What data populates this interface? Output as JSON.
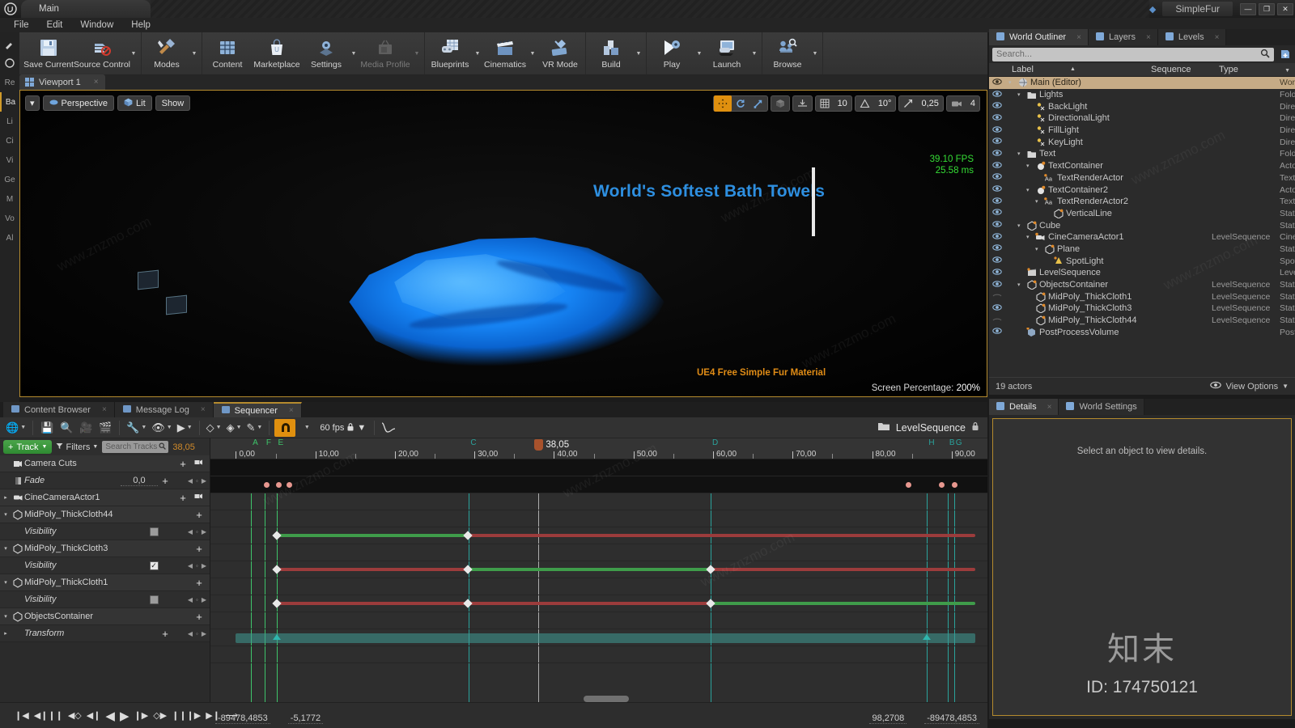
{
  "titlebar": {
    "project_tab": "Main",
    "app_name": "SimpleFur",
    "minimize": "—",
    "maximize": "❐",
    "close": "✕"
  },
  "menubar": {
    "items": [
      "File",
      "Edit",
      "Window",
      "Help"
    ]
  },
  "toolbar": {
    "groups": [
      {
        "buttons": [
          {
            "label": "Save Current",
            "icon": "save-icon",
            "caret": false,
            "disabled": false
          },
          {
            "label": "Source Control",
            "icon": "source-control-icon",
            "caret": true,
            "disabled": false
          }
        ]
      },
      {
        "buttons": [
          {
            "label": "Modes",
            "icon": "modes-icon",
            "caret": true,
            "disabled": false
          }
        ]
      },
      {
        "buttons": [
          {
            "label": "Content",
            "icon": "content-icon",
            "caret": false,
            "disabled": false
          },
          {
            "label": "Marketplace",
            "icon": "marketplace-icon",
            "caret": false,
            "disabled": false
          },
          {
            "label": "Settings",
            "icon": "settings-gear-icon",
            "caret": true,
            "disabled": false
          },
          {
            "label": "Media Profile",
            "icon": "media-profile-icon",
            "caret": true,
            "disabled": true
          }
        ]
      },
      {
        "buttons": [
          {
            "label": "Blueprints",
            "icon": "blueprints-icon",
            "caret": true,
            "disabled": false
          },
          {
            "label": "Cinematics",
            "icon": "cinematics-clapper-icon",
            "caret": true,
            "disabled": false
          },
          {
            "label": "VR Mode",
            "icon": "vr-mode-icon",
            "caret": false,
            "disabled": false
          }
        ]
      },
      {
        "buttons": [
          {
            "label": "Build",
            "icon": "build-icon",
            "caret": true,
            "disabled": false
          }
        ]
      },
      {
        "buttons": [
          {
            "label": "Play",
            "icon": "play-icon",
            "caret": true,
            "disabled": false
          },
          {
            "label": "Launch",
            "icon": "launch-icon",
            "caret": true,
            "disabled": false
          }
        ]
      },
      {
        "buttons": [
          {
            "label": "Browse",
            "icon": "browse-icon",
            "caret": true,
            "disabled": false
          }
        ]
      }
    ]
  },
  "mode_rail": {
    "items": [
      "Re",
      "Ba",
      "Li",
      "Ci",
      "Vi",
      "Ge",
      "M",
      "Vo",
      "Al"
    ],
    "selected_index": 1
  },
  "viewport": {
    "tab_label": "Viewport 1",
    "tab_close": "×",
    "left_controls": [
      {
        "label": "Perspective",
        "icon": "camera-perspective-icon"
      },
      {
        "label": "Lit",
        "icon": "lit-cube-icon"
      },
      {
        "label": "Show",
        "icon": "show-icon"
      }
    ],
    "right_controls": {
      "transform_modes": [
        "move",
        "rotate",
        "scale"
      ],
      "active_transform": "move",
      "coord_space": "world-cube-icon",
      "surface_snap": "surface-snap-icon",
      "grid_snap_icon": "grid-icon",
      "grid_snap_value": "10",
      "angle_snap_icon": "angle-icon",
      "angle_snap_value": "10°",
      "scale_snap_icon": "scale-snap-icon",
      "scale_snap_value": "0,25",
      "camera_speed_icon": "camera-speed-icon",
      "camera_speed_value": "4"
    },
    "stats": {
      "fps": "39.10 FPS",
      "frametime": "25.58 ms"
    },
    "headline_text": "World's Softest Bath Towels",
    "subtitle_text": "UE4 Free Simple Fur Material",
    "screen_percentage_label": "Screen Percentage:",
    "screen_percentage_value": "200%"
  },
  "outliner": {
    "tabs": [
      {
        "label": "World Outliner",
        "icon": "list-icon",
        "active": true,
        "closable": true
      },
      {
        "label": "Layers",
        "icon": "layers-icon",
        "active": false,
        "closable": true
      },
      {
        "label": "Levels",
        "icon": "levels-icon",
        "active": false,
        "closable": true
      }
    ],
    "search_placeholder": "Search...",
    "search_icon": "magnifier-icon",
    "add_icon": "add-actor-icon",
    "columns": {
      "label": "Label",
      "sequence": "Sequence",
      "type": "Type"
    },
    "rows": [
      {
        "label": "Main (Editor)",
        "sequence": "",
        "type": "World",
        "indent": 0,
        "icon": "world-icon",
        "expander": "▾",
        "eye": true,
        "selected": true
      },
      {
        "label": "Lights",
        "sequence": "",
        "type": "Folder",
        "indent": 1,
        "icon": "folder-icon",
        "expander": "▾",
        "eye": true,
        "selected": false
      },
      {
        "label": "BackLight",
        "sequence": "",
        "type": "DirectionalLight",
        "indent": 2,
        "icon": "light-icon",
        "expander": "",
        "eye": true,
        "selected": false
      },
      {
        "label": "DirectionalLight",
        "sequence": "",
        "type": "DirectionalLight",
        "indent": 2,
        "icon": "light-icon",
        "expander": "",
        "eye": true,
        "selected": false
      },
      {
        "label": "FillLight",
        "sequence": "",
        "type": "DirectionalLight",
        "indent": 2,
        "icon": "light-icon",
        "expander": "",
        "eye": true,
        "selected": false
      },
      {
        "label": "KeyLight",
        "sequence": "",
        "type": "DirectionalLight",
        "indent": 2,
        "icon": "light-icon",
        "expander": "",
        "eye": true,
        "selected": false
      },
      {
        "label": "Text",
        "sequence": "",
        "type": "Folder",
        "indent": 1,
        "icon": "folder-icon",
        "expander": "▾",
        "eye": true,
        "selected": false
      },
      {
        "label": "TextContainer",
        "sequence": "",
        "type": "Actor",
        "indent": 2,
        "icon": "actor-sphere-icon",
        "expander": "▾",
        "eye": true,
        "selected": false
      },
      {
        "label": "TextRenderActor",
        "sequence": "",
        "type": "TextRenderActor",
        "indent": 3,
        "icon": "text-render-icon",
        "expander": "",
        "eye": true,
        "selected": false
      },
      {
        "label": "TextContainer2",
        "sequence": "",
        "type": "Actor",
        "indent": 2,
        "icon": "actor-sphere-icon",
        "expander": "▾",
        "eye": true,
        "selected": false
      },
      {
        "label": "TextRenderActor2",
        "sequence": "",
        "type": "TextRenderActor",
        "indent": 3,
        "icon": "text-render-icon",
        "expander": "▾",
        "eye": true,
        "selected": false
      },
      {
        "label": "VerticalLine",
        "sequence": "",
        "type": "StaticMeshActor",
        "indent": 4,
        "icon": "mesh-icon",
        "expander": "",
        "eye": true,
        "selected": false
      },
      {
        "label": "Cube",
        "sequence": "",
        "type": "StaticMeshActor",
        "indent": 1,
        "icon": "mesh-icon",
        "expander": "▾",
        "eye": true,
        "selected": false
      },
      {
        "label": "CineCameraActor1",
        "sequence": "LevelSequence",
        "type": "CineCameraActor",
        "indent": 2,
        "icon": "cine-camera-icon",
        "expander": "▾",
        "eye": true,
        "selected": false
      },
      {
        "label": "Plane",
        "sequence": "",
        "type": "StaticMeshActor",
        "indent": 3,
        "icon": "mesh-icon",
        "expander": "▾",
        "eye": true,
        "selected": false
      },
      {
        "label": "SpotLight",
        "sequence": "",
        "type": "SpotLight",
        "indent": 4,
        "icon": "spotlight-icon",
        "expander": "",
        "eye": true,
        "selected": false
      },
      {
        "label": "LevelSequence",
        "sequence": "",
        "type": "LevelSequenceActor",
        "indent": 1,
        "icon": "sequence-icon",
        "expander": "",
        "eye": true,
        "selected": false
      },
      {
        "label": "ObjectsContainer",
        "sequence": "LevelSequence",
        "type": "StaticMeshActor",
        "indent": 1,
        "icon": "mesh-icon",
        "expander": "▾",
        "eye": true,
        "selected": false
      },
      {
        "label": "MidPoly_ThickCloth1",
        "sequence": "LevelSequence",
        "type": "StaticMeshActor",
        "indent": 2,
        "icon": "mesh-icon",
        "expander": "",
        "eye": false,
        "selected": false
      },
      {
        "label": "MidPoly_ThickCloth3",
        "sequence": "LevelSequence",
        "type": "StaticMeshActor",
        "indent": 2,
        "icon": "mesh-icon",
        "expander": "",
        "eye": true,
        "selected": false
      },
      {
        "label": "MidPoly_ThickCloth44",
        "sequence": "LevelSequence",
        "type": "StaticMeshActor",
        "indent": 2,
        "icon": "mesh-icon",
        "expander": "",
        "eye": false,
        "selected": false
      },
      {
        "label": "PostProcessVolume",
        "sequence": "",
        "type": "PostProcessVolume",
        "indent": 1,
        "icon": "volume-icon",
        "expander": "",
        "eye": true,
        "selected": false
      }
    ],
    "actor_count": "19 actors",
    "view_options": "View Options",
    "view_options_icon": "eye-icon"
  },
  "details": {
    "tabs": [
      {
        "label": "Details",
        "icon": "info-icon",
        "active": true,
        "closable": true
      },
      {
        "label": "World Settings",
        "icon": "globe-icon",
        "active": false,
        "closable": false
      }
    ],
    "empty_message": "Select an object to view details."
  },
  "watermark": {
    "big": "知末",
    "id": "ID: 174750121"
  },
  "sequencer": {
    "dock_tabs": [
      {
        "label": "Content Browser",
        "icon": "content-browser-icon",
        "active": false,
        "closable": true
      },
      {
        "label": "Message Log",
        "icon": "message-log-icon",
        "active": false,
        "closable": true
      },
      {
        "label": "Sequencer",
        "icon": "sequencer-icon",
        "active": true,
        "closable": true
      }
    ],
    "toolbar": {
      "buttons": [
        {
          "icon": "world-dropdown-icon",
          "caret": true
        },
        {
          "icon": "save-icon",
          "caret": false
        },
        {
          "icon": "find-icon",
          "caret": false
        },
        {
          "icon": "create-camera-icon",
          "caret": false
        },
        {
          "icon": "render-movie-icon",
          "caret": false
        },
        {
          "icon": "wrench-icon",
          "caret": true
        },
        {
          "icon": "eye-options-icon",
          "caret": true
        },
        {
          "icon": "playback-options-icon",
          "caret": true
        },
        {
          "icon": "key-interpolation-icon",
          "caret": true
        },
        {
          "icon": "keyframe-icon",
          "caret": true
        },
        {
          "icon": "autokey-pen-icon",
          "caret": true
        }
      ],
      "snap_icon": "magnet-snap-icon",
      "snap_caret": true,
      "fps_label": "60 fps",
      "fps_lock_icon": "lock-icon",
      "curve_editor_icon": "curve-editor-icon",
      "sequence_name": "LevelSequence",
      "sequence_icon": "folder-open-icon"
    },
    "track_toolbar": {
      "add_track_label": "Track",
      "add_track_plus": "+",
      "filters_label": "Filters",
      "filter_icon": "funnel-icon",
      "search_placeholder": "Search Tracks",
      "search_icon": "magnifier-icon",
      "current_time": "38,05"
    },
    "tracks": [
      {
        "name": "Camera Cuts",
        "type": "master",
        "icon": "camera-cuts-icon",
        "expander": "",
        "plus": "+",
        "extra_icon": "camera-icon",
        "value": null,
        "checkbox": null
      },
      {
        "name": "Fade",
        "type": "sub",
        "icon": "fade-icon",
        "expander": "",
        "plus": "+",
        "extra_icon": null,
        "value": "0,0",
        "checkbox": null
      },
      {
        "name": "CineCameraActor1",
        "type": "object",
        "icon": "cine-camera-icon",
        "expander": "▸",
        "plus": "+",
        "extra_icon": "camera-icon",
        "value": null,
        "checkbox": null
      },
      {
        "name": "MidPoly_ThickCloth44",
        "type": "object",
        "icon": "mesh-icon",
        "expander": "▾",
        "plus": "+",
        "extra_icon": null,
        "value": null,
        "checkbox": null
      },
      {
        "name": "Visibility",
        "type": "sub",
        "icon": "",
        "expander": "",
        "plus": null,
        "extra_icon": null,
        "value": null,
        "checkbox": false
      },
      {
        "name": "MidPoly_ThickCloth3",
        "type": "object",
        "icon": "mesh-icon",
        "expander": "▾",
        "plus": "+",
        "extra_icon": null,
        "value": null,
        "checkbox": null
      },
      {
        "name": "Visibility",
        "type": "sub",
        "icon": "",
        "expander": "",
        "plus": null,
        "extra_icon": null,
        "value": null,
        "checkbox": true
      },
      {
        "name": "MidPoly_ThickCloth1",
        "type": "object",
        "icon": "mesh-icon",
        "expander": "▾",
        "plus": "+",
        "extra_icon": null,
        "value": null,
        "checkbox": null
      },
      {
        "name": "Visibility",
        "type": "sub",
        "icon": "",
        "expander": "",
        "plus": null,
        "extra_icon": null,
        "value": null,
        "checkbox": false
      },
      {
        "name": "ObjectsContainer",
        "type": "object",
        "icon": "mesh-icon",
        "expander": "▾",
        "plus": "+",
        "extra_icon": null,
        "value": null,
        "checkbox": null
      },
      {
        "name": "Transform",
        "type": "sub",
        "icon": "",
        "expander": "▸",
        "plus": "+",
        "extra_icon": null,
        "value": null,
        "checkbox": null
      }
    ],
    "timeline": {
      "sequence_label": "CineCameraActor1",
      "tick_labels": [
        "0,00",
        "10,00",
        "20,00",
        "30,00",
        "40,00",
        "50,00",
        "60,00",
        "70,00",
        "80,00",
        "90,00"
      ],
      "tick_values": [
        0,
        10,
        20,
        30,
        40,
        50,
        60,
        70,
        80,
        90
      ],
      "playhead_time": "38,05",
      "playhead_value": 38.05,
      "markers": [
        {
          "label": "A",
          "value": 1.9,
          "color": "#3ec46a"
        },
        {
          "label": "F",
          "value": 3.6,
          "color": "#3ec46a"
        },
        {
          "label": "E",
          "value": 5.1,
          "color": "#3ec46a"
        },
        {
          "label": "C",
          "value": 29.3,
          "color": "#2aa39c"
        },
        {
          "label": "D",
          "value": 59.7,
          "color": "#2aa39c"
        },
        {
          "label": "H",
          "value": 86.9,
          "color": "#2aa39c"
        },
        {
          "label": "B",
          "value": 89.5,
          "color": "#2aa39c"
        },
        {
          "label": "G",
          "value": 90.3,
          "color": "#2aa39c"
        }
      ],
      "fade_keys": [
        3.9,
        5.4,
        6.7,
        84.6,
        88.8,
        90.4
      ],
      "visibility_tracks": [
        {
          "keys": [
            5.1,
            29.2
          ],
          "segments": [
            {
              "from": 5.1,
              "to": 29.2,
              "color": "green"
            },
            {
              "from": 29.2,
              "to": 93,
              "color": "red"
            }
          ]
        },
        {
          "keys": [
            5.1,
            29.2,
            59.7
          ],
          "segments": [
            {
              "from": 5.1,
              "to": 29.2,
              "color": "red"
            },
            {
              "from": 29.2,
              "to": 59.7,
              "color": "green"
            },
            {
              "from": 59.7,
              "to": 93,
              "color": "red"
            }
          ]
        },
        {
          "keys": [
            5.1,
            29.2,
            59.7
          ],
          "segments": [
            {
              "from": 5.1,
              "to": 29.2,
              "color": "red"
            },
            {
              "from": 29.2,
              "to": 59.7,
              "color": "red"
            },
            {
              "from": 59.7,
              "to": 93,
              "color": "green"
            }
          ]
        }
      ],
      "transform_keys": [
        5.1,
        86.9
      ],
      "transform_band": {
        "from": 0,
        "to": 93
      }
    },
    "transport": {
      "buttons": [
        "jump-to-start",
        "step-back-frames",
        "previous-key",
        "step-back",
        "play-reverse",
        "play-forward",
        "step-forward",
        "next-key",
        "step-forward-frames",
        "jump-to-end",
        "loop-mode"
      ]
    },
    "range_values": {
      "in_start": "-89478,4853",
      "in_end": "-5,1772",
      "out_start": "98,2708",
      "out_end": "-89478,4853"
    }
  }
}
